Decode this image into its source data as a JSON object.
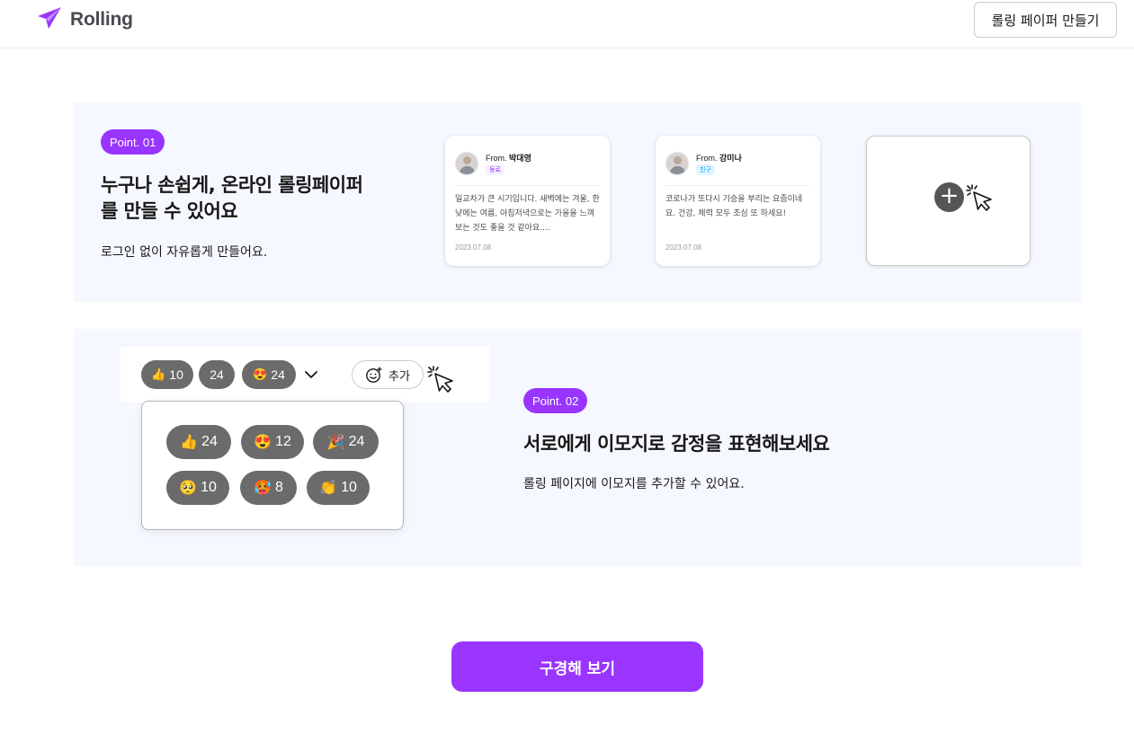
{
  "header": {
    "logo_text": "Rolling",
    "logo_icon": "paper-plane-icon",
    "create_button_label": "롤링 페이퍼 만들기"
  },
  "section1": {
    "badge": "Point. 01",
    "title_line1": "누구나 손쉽게, 온라인 롤링페이퍼",
    "title_line2": "를 만들 수 있어요",
    "description": "로그인 없이 자유롭게 만들어요.",
    "cards": [
      {
        "from_prefix": "From.",
        "from_name": "박대영",
        "tag": "동료",
        "body": "일교차가 큰 시기입니다. 새벽에는 겨울, 한낮에는 여름, 아침저녁으로는 가을을 느껴보는 것도 좋을 것 같아요....",
        "date": "2023.07.08"
      },
      {
        "from_prefix": "From.",
        "from_name": "강미나",
        "tag": "친구",
        "body": "코로나가 또다시 기승을 부리는 요즘이네요. 건강, 체력 모두 조심 또 하세요!",
        "date": "2023.07.08"
      }
    ],
    "add_card_icon": "plus-icon"
  },
  "section2": {
    "badge": "Point. 02",
    "title": "서로에게 이모지로 감정을 표현해보세요",
    "description": "롤링 페이지에 이모지를 추가할 수 있어요.",
    "top_reactions": [
      {
        "emoji": "👍",
        "count": "10"
      },
      {
        "emoji": "",
        "count": "24"
      },
      {
        "emoji": "😍",
        "count": "24"
      }
    ],
    "add_button_label": "추가",
    "panel_reactions": [
      {
        "emoji": "👍",
        "count": "24"
      },
      {
        "emoji": "😍",
        "count": "12"
      },
      {
        "emoji": "🎉",
        "count": "24"
      },
      {
        "emoji": "🥺",
        "count": "10"
      },
      {
        "emoji": "🥵",
        "count": "8"
      },
      {
        "emoji": "👏",
        "count": "10"
      }
    ]
  },
  "cta": {
    "label": "구경해 보기"
  },
  "colors": {
    "primary": "#9935ff",
    "section_bg": "#f6f8ff",
    "pill_bg": "#6b6b6b"
  }
}
